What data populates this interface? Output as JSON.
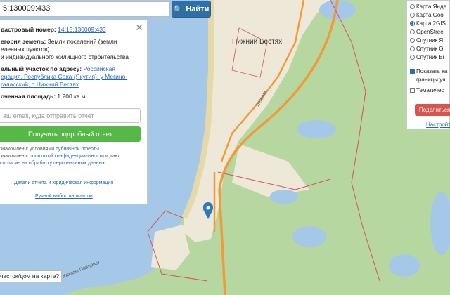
{
  "search": {
    "value": "5:130009:433",
    "button": "Найти"
  },
  "panel": {
    "cadastral_label": "дастровый номер:",
    "cadastral_value": "14:15:130009:433",
    "category_label": "егория земель:",
    "category_line1": "Земли поселений (земли",
    "category_line2": "еленных пунктов)",
    "use_line": "и индивидуального жилищного строительства",
    "address_label": "ельный участок по адресу:",
    "address_link": "Российская",
    "address_line2": "ерация, Республика Саха (Якутия), у Мегино-",
    "address_line3": "галасский, п Нижний Бестях",
    "area_label": "оченная площадь:",
    "area_value": "1 200 кв.м.",
    "email_placeholder": "аш email, куда отправить отчет",
    "get_report": "Получить подробный отчет",
    "agree1": "знакомлен с условиями",
    "agree1_link": "публичной оферты",
    "agree2": "знакомлен с",
    "agree2_link": "политикой конфиденциальности",
    "agree2_tail": "и даю",
    "agree3_link": "согласие на обработку персональных данных",
    "details_link": "Детали отчета и юридическая информация",
    "manual_link": "Ручной выбор вариантов"
  },
  "layers": {
    "options": [
      "Карта Янде",
      "Карта Goo",
      "Карта 2GIS",
      "OpenStree",
      "Спутник Я",
      "Спутник G",
      "Спутник Bi"
    ],
    "selected_index": 2,
    "show_bounds_1": "Показать ка",
    "show_bounds_2": "границы уч",
    "thematic": "Тематичес",
    "share": "Поделиться",
    "settings": "Настройт"
  },
  "map": {
    "town_label": "Нижний Бестях",
    "street_label": "Ленина",
    "bottom_label": "Хатасы Павловск"
  },
  "ask": "часток/дом на карте?",
  "colors": {
    "water": "#a6c8e8",
    "forest": "#b6d79f",
    "town": "#ede8d8",
    "road": "#f29a3a",
    "primary": "#2f6fa7",
    "green": "#56b947",
    "red": "#d9534f"
  }
}
